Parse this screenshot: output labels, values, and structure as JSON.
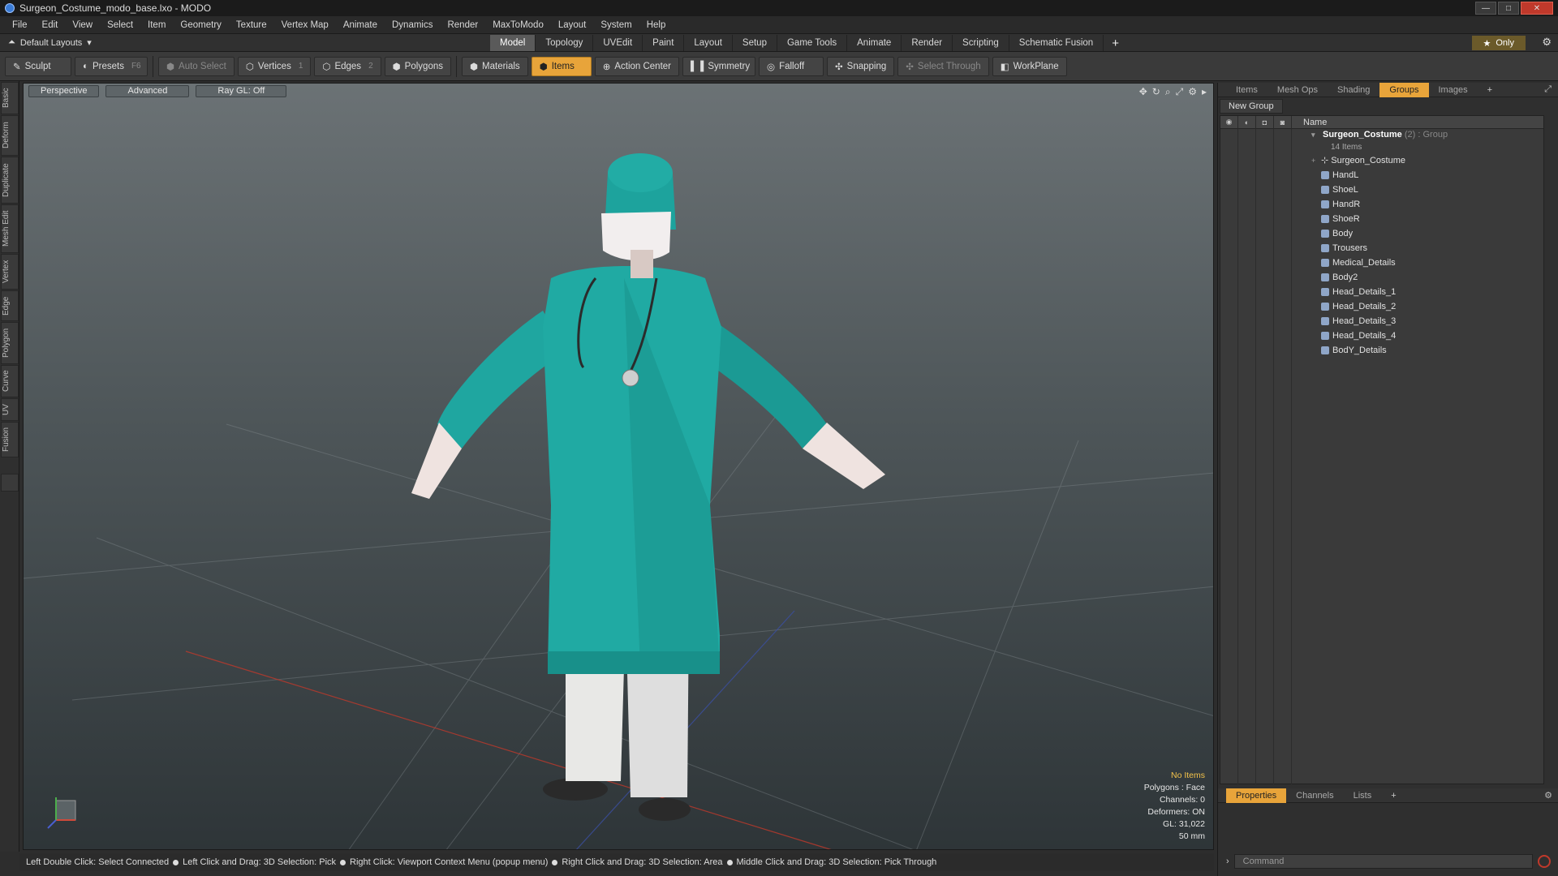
{
  "window": {
    "title": "Surgeon_Costume_modo_base.lxo - MODO"
  },
  "menubar": [
    "File",
    "Edit",
    "View",
    "Select",
    "Item",
    "Geometry",
    "Texture",
    "Vertex Map",
    "Animate",
    "Dynamics",
    "Render",
    "MaxToModo",
    "Layout",
    "System",
    "Help"
  ],
  "layoutbar": {
    "layout": "Default Layouts",
    "tabs": [
      "Model",
      "Topology",
      "UVEdit",
      "Paint",
      "Layout",
      "Setup",
      "Game Tools",
      "Animate",
      "Render",
      "Scripting",
      "Schematic Fusion"
    ],
    "active_tab": "Model",
    "only_label": "Only"
  },
  "toolbar": {
    "sculpt": "Sculpt",
    "presets": "Presets",
    "presets_shortcut": "F6",
    "auto_select": "Auto Select",
    "vertices": "Vertices",
    "vertices_shortcut": "1",
    "edges": "Edges",
    "edges_shortcut": "2",
    "polygons": "Polygons",
    "materials": "Materials",
    "items": "Items",
    "action_center": "Action Center",
    "symmetry": "Symmetry",
    "falloff": "Falloff",
    "snapping": "Snapping",
    "select_through": "Select Through",
    "workplane": "WorkPlane"
  },
  "left_tabs": [
    "Basic",
    "Deform",
    "Duplicate",
    "Mesh Edit",
    "Vertex",
    "Edge",
    "Polygon",
    "Curve",
    "UV",
    "Fusion"
  ],
  "viewport": {
    "view": "Perspective",
    "advanced": "Advanced",
    "raygl": "Ray GL: Off",
    "stats": {
      "selection": "No Items",
      "polygons": "Polygons : Face",
      "channels": "Channels: 0",
      "deformers": "Deformers: ON",
      "gl": "GL: 31,022",
      "focal": "50 mm"
    }
  },
  "statusbar": {
    "hints": [
      "Left Double Click: Select Connected",
      "Left Click and Drag: 3D Selection: Pick",
      "Right Click: Viewport Context Menu (popup menu)",
      "Right Click and Drag: 3D Selection: Area",
      "Middle Click and Drag: 3D Selection: Pick Through"
    ]
  },
  "right_panel": {
    "tabs": [
      "Items",
      "Mesh Ops",
      "Shading",
      "Groups",
      "Images"
    ],
    "active_tab": "Groups",
    "new_group": "New Group",
    "name_header": "Name",
    "group": {
      "name": "Surgeon_Costume",
      "suffix": "(2)",
      "type": ": Group",
      "count": "14 Items"
    },
    "items": [
      "Surgeon_Costume",
      "HandL",
      "ShoeL",
      "HandR",
      "ShoeR",
      "Body",
      "Trousers",
      "Medical_Details",
      "Body2",
      "Head_Details_1",
      "Head_Details_2",
      "Head_Details_3",
      "Head_Details_4",
      "BodY_Details"
    ],
    "bottom_tabs": [
      "Properties",
      "Channels",
      "Lists"
    ],
    "bottom_active": "Properties",
    "command_placeholder": "Command"
  },
  "colors": {
    "accent": "#e8a43a",
    "gown": "#1fa6a0",
    "trousers": "#e8e8e6"
  }
}
